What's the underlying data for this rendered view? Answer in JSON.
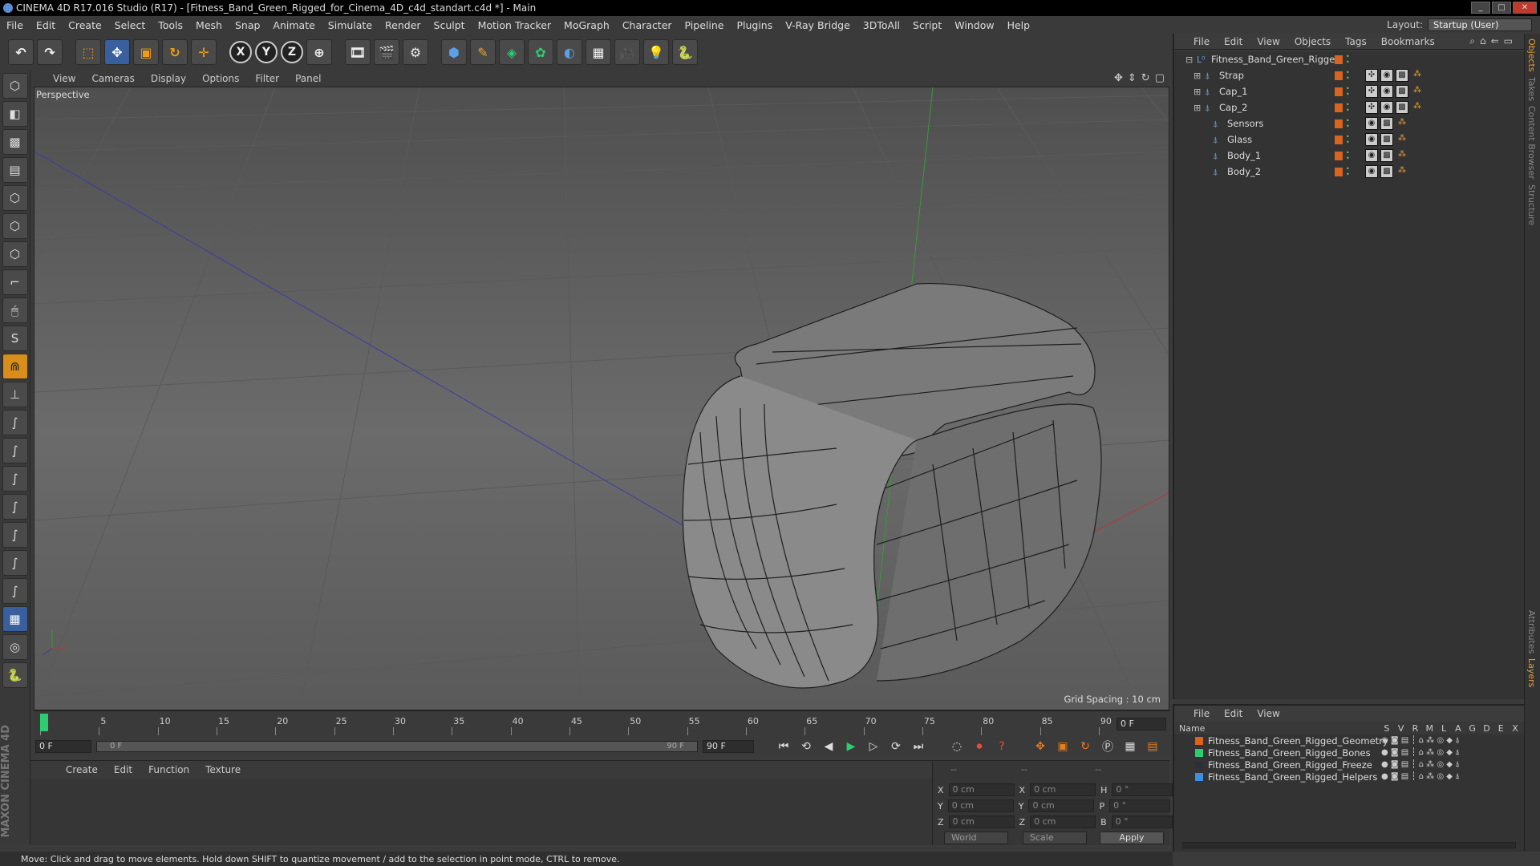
{
  "window": {
    "title": "CINEMA 4D R17.016 Studio (R17) - [Fitness_Band_Green_Rigged_for_Cinema_4D_c4d_standart.c4d *] - Main",
    "min": "_",
    "max": "□",
    "close": "✕"
  },
  "menubar": {
    "items": [
      "File",
      "Edit",
      "Create",
      "Select",
      "Tools",
      "Mesh",
      "Snap",
      "Animate",
      "Simulate",
      "Render",
      "Sculpt",
      "Motion Tracker",
      "MoGraph",
      "Character",
      "Pipeline",
      "Plugins",
      "V-Ray Bridge",
      "3DToAll",
      "Script",
      "Window",
      "Help"
    ],
    "layout_label": "Layout:",
    "layout_value": "Startup (User)"
  },
  "toolbar": {
    "undo_icon": "undo-icon",
    "redo_icon": "redo-icon",
    "x_label": "X",
    "y_label": "Y",
    "z_label": "Z"
  },
  "viewport": {
    "menu": [
      "View",
      "Cameras",
      "Display",
      "Options",
      "Filter",
      "Panel"
    ],
    "label": "Perspective",
    "grid_spacing": "Grid Spacing : 10 cm"
  },
  "timeline": {
    "ticks": [
      "0",
      "5",
      "10",
      "15",
      "20",
      "25",
      "30",
      "35",
      "40",
      "45",
      "50",
      "55",
      "60",
      "65",
      "70",
      "75",
      "80",
      "85",
      "90"
    ],
    "frame_end_box": "0 F",
    "start_field": "0 F",
    "slider_left": "0 F",
    "slider_right": "90 F",
    "end_field": "90 F"
  },
  "material": {
    "menu": [
      "Create",
      "Edit",
      "Function",
      "Texture"
    ]
  },
  "coords": {
    "header_a": "--",
    "header_b": "--",
    "header_c": "--",
    "rows": [
      {
        "a": "X",
        "av": "0 cm",
        "b": "X",
        "bv": "0 cm",
        "c": "H",
        "cv": "0 °"
      },
      {
        "a": "Y",
        "av": "0 cm",
        "b": "Y",
        "bv": "0 cm",
        "c": "P",
        "cv": "0 °"
      },
      {
        "a": "Z",
        "av": "0 cm",
        "b": "Z",
        "bv": "0 cm",
        "c": "B",
        "cv": "0 °"
      }
    ],
    "world": "World",
    "scale": "Scale",
    "apply": "Apply"
  },
  "status": "Move: Click and drag to move elements. Hold down SHIFT to quantize movement / add to the selection in point mode, CTRL to remove.",
  "objects": {
    "menu": [
      "File",
      "Edit",
      "View",
      "Objects",
      "Tags",
      "Bookmarks"
    ],
    "tree": [
      {
        "name": "Fitness_Band_Green_Rigged",
        "level": 0
      },
      {
        "name": "Strap",
        "level": 1
      },
      {
        "name": "Cap_1",
        "level": 1
      },
      {
        "name": "Cap_2",
        "level": 1
      },
      {
        "name": "Sensors",
        "level": 2
      },
      {
        "name": "Glass",
        "level": 2
      },
      {
        "name": "Body_1",
        "level": 2
      },
      {
        "name": "Body_2",
        "level": 2
      }
    ]
  },
  "layers": {
    "menu": [
      "File",
      "Edit",
      "View"
    ],
    "header_name": "Name",
    "columns": [
      "S",
      "V",
      "R",
      "M",
      "L",
      "A",
      "G",
      "D",
      "E",
      "X"
    ],
    "items": [
      {
        "name": "Fitness_Band_Green_Rigged_Geometry",
        "color": "#d9641e"
      },
      {
        "name": "Fitness_Band_Green_Rigged_Bones",
        "color": "#2ecc71"
      },
      {
        "name": "Fitness_Band_Green_Rigged_Freeze",
        "color": "#2e2e3a"
      },
      {
        "name": "Fitness_Band_Green_Rigged_Helpers",
        "color": "#3a8ee6"
      }
    ]
  },
  "sidetabs": [
    "Objects",
    "Takes",
    "Content Browser",
    "Structure",
    "Attributes",
    "Layers"
  ],
  "brand": "MAXON CINEMA 4D"
}
